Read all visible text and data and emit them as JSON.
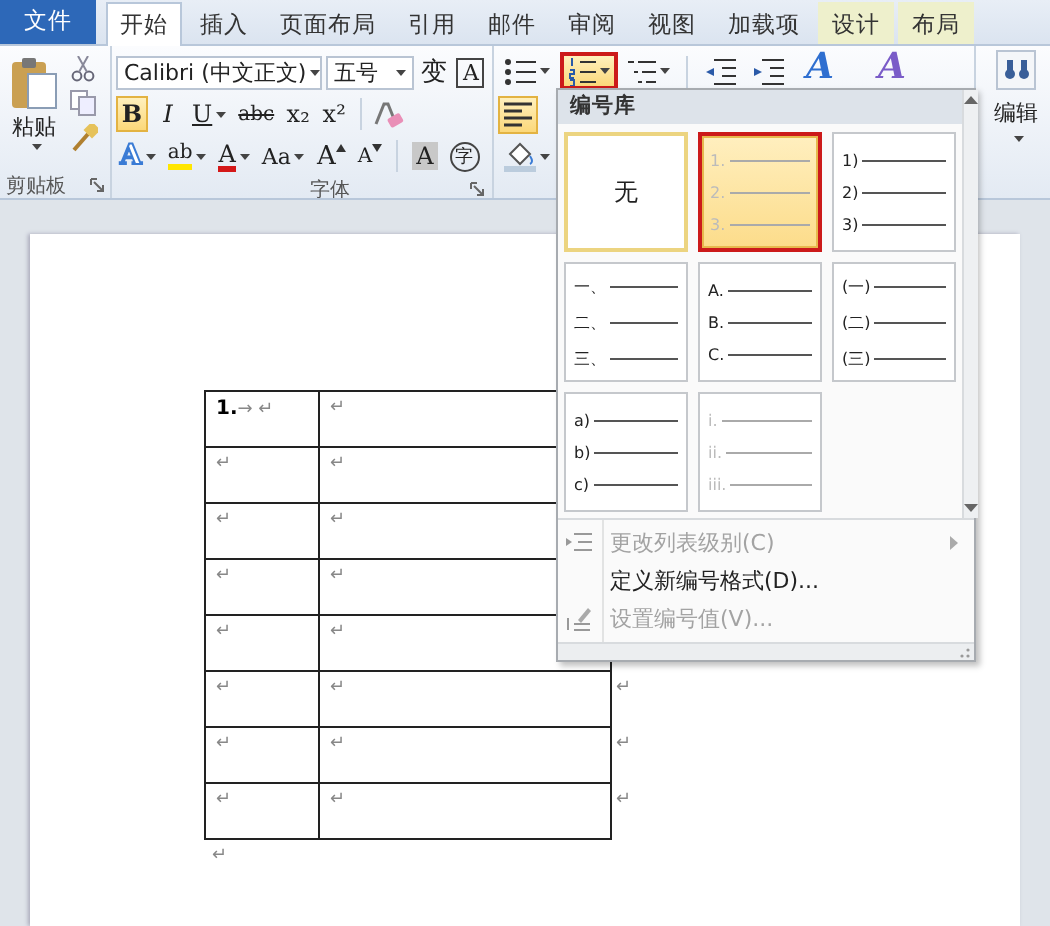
{
  "tabs": [
    {
      "label": "文件",
      "kind": "file",
      "selected": false
    },
    {
      "label": "开始",
      "kind": "tab",
      "selected": true
    },
    {
      "label": "插入",
      "kind": "tab",
      "selected": false
    },
    {
      "label": "页面布局",
      "kind": "tab",
      "selected": false
    },
    {
      "label": "引用",
      "kind": "tab",
      "selected": false
    },
    {
      "label": "邮件",
      "kind": "tab",
      "selected": false
    },
    {
      "label": "审阅",
      "kind": "tab",
      "selected": false
    },
    {
      "label": "视图",
      "kind": "tab",
      "selected": false
    },
    {
      "label": "加载项",
      "kind": "tab",
      "selected": false
    },
    {
      "label": "设计",
      "kind": "contextual",
      "selected": false
    },
    {
      "label": "布局",
      "kind": "contextual",
      "selected": false
    }
  ],
  "ribbon": {
    "clipboard": {
      "paste": "粘贴",
      "label": "剪贴板"
    },
    "font": {
      "name": "Calibri (中文正文)",
      "size": "五号",
      "label": "字体",
      "buttons": [
        {
          "kind": "phonetic",
          "label": "变",
          "caret": false,
          "selected": false
        },
        {
          "kind": "border",
          "label": "A",
          "caret": false,
          "selected": false
        },
        {
          "kind": "bold",
          "label": "B",
          "caret": false,
          "selected": true
        },
        {
          "kind": "italic",
          "label": "I",
          "caret": false,
          "selected": false
        },
        {
          "kind": "underline",
          "label": "U",
          "caret": true,
          "selected": false
        },
        {
          "kind": "strike",
          "label": "abc",
          "caret": false,
          "selected": false
        },
        {
          "kind": "sub",
          "label": "x₂",
          "caret": false,
          "selected": false
        },
        {
          "kind": "sup",
          "label": "x²",
          "caret": false,
          "selected": false
        },
        {
          "kind": "effect",
          "label": "A",
          "caret": true,
          "selected": false
        },
        {
          "kind": "highlight",
          "label": "ab",
          "caret": true,
          "selected": false
        },
        {
          "kind": "color",
          "label": "A",
          "caret": true,
          "selected": false
        },
        {
          "kind": "case",
          "label": "Aa",
          "caret": true,
          "selected": false
        },
        {
          "kind": "grow",
          "label": "A",
          "caret": false,
          "selected": false
        },
        {
          "kind": "shrink",
          "label": "A",
          "caret": false,
          "selected": false
        },
        {
          "kind": "shade",
          "label": "A",
          "caret": false,
          "selected": false
        },
        {
          "kind": "enclose",
          "label": "字",
          "caret": false,
          "selected": false
        }
      ]
    },
    "paragraph": {
      "buttons": [
        {
          "kind": "bullets",
          "selected": false,
          "annotated": false
        },
        {
          "kind": "numbering",
          "selected": true,
          "annotated": true
        },
        {
          "kind": "multilevel",
          "selected": false,
          "annotated": false
        },
        {
          "kind": "decrease_indent",
          "selected": false,
          "annotated": false
        },
        {
          "kind": "increase_indent",
          "selected": false,
          "annotated": false
        },
        {
          "kind": "align_left",
          "selected": true,
          "annotated": false
        },
        {
          "kind": "shading",
          "selected": false,
          "annotated": false
        }
      ]
    },
    "styles": [
      {
        "kind": "quick_styles",
        "label": "A"
      },
      {
        "kind": "change_styles",
        "label": "A"
      }
    ],
    "editing": {
      "label": "编辑"
    }
  },
  "document": {
    "rows": [
      {
        "cells": [
          "**1.**→ ↵",
          "↵"
        ]
      },
      {
        "cells": [
          "↵",
          "↵"
        ]
      },
      {
        "cells": [
          "↵",
          "↵"
        ]
      },
      {
        "cells": [
          "↵",
          "↵"
        ]
      },
      {
        "cells": [
          "↵",
          "↵"
        ]
      },
      {
        "cells": [
          "↵",
          "↵"
        ],
        "end_mark": "↵"
      },
      {
        "cells": [
          "↵",
          "↵"
        ],
        "end_mark": "↵"
      },
      {
        "cells": [
          "↵",
          "↵"
        ],
        "end_mark": "↵"
      }
    ],
    "after_table": "↵"
  },
  "numbering_menu": {
    "title": "编号库",
    "library": [
      {
        "kind": "none",
        "label": "无",
        "selected": false,
        "current": true,
        "annotated": false,
        "faded": false
      },
      {
        "kind": "list",
        "markers": [
          "1.",
          "2.",
          "3."
        ],
        "selected": true,
        "current": false,
        "annotated": true,
        "faded": true
      },
      {
        "kind": "list",
        "markers": [
          "1)",
          "2)",
          "3)"
        ],
        "selected": false,
        "current": false,
        "annotated": false,
        "faded": false
      },
      {
        "kind": "list",
        "markers": [
          "一、",
          "二、",
          "三、"
        ],
        "selected": false,
        "current": false,
        "annotated": false,
        "faded": false
      },
      {
        "kind": "list",
        "markers": [
          "A.",
          "B.",
          "C."
        ],
        "selected": false,
        "current": false,
        "annotated": false,
        "faded": false
      },
      {
        "kind": "list",
        "markers": [
          "(一)",
          "(二)",
          "(三)"
        ],
        "selected": false,
        "current": false,
        "annotated": false,
        "faded": false
      },
      {
        "kind": "list",
        "markers": [
          "a)",
          "b)",
          "c)"
        ],
        "selected": false,
        "current": false,
        "annotated": false,
        "faded": false
      },
      {
        "kind": "list",
        "markers": [
          "i.",
          "ii.",
          "iii."
        ],
        "selected": false,
        "current": false,
        "annotated": false,
        "faded": true
      }
    ],
    "items": [
      {
        "kind": "change_level",
        "label": "更改列表级别(C)",
        "disabled": true,
        "submenu": true
      },
      {
        "kind": "define",
        "label": "定义新编号格式(D)...",
        "disabled": false,
        "submenu": false
      },
      {
        "kind": "set_value",
        "label": "设置编号值(V)...",
        "disabled": true,
        "submenu": false
      }
    ]
  }
}
